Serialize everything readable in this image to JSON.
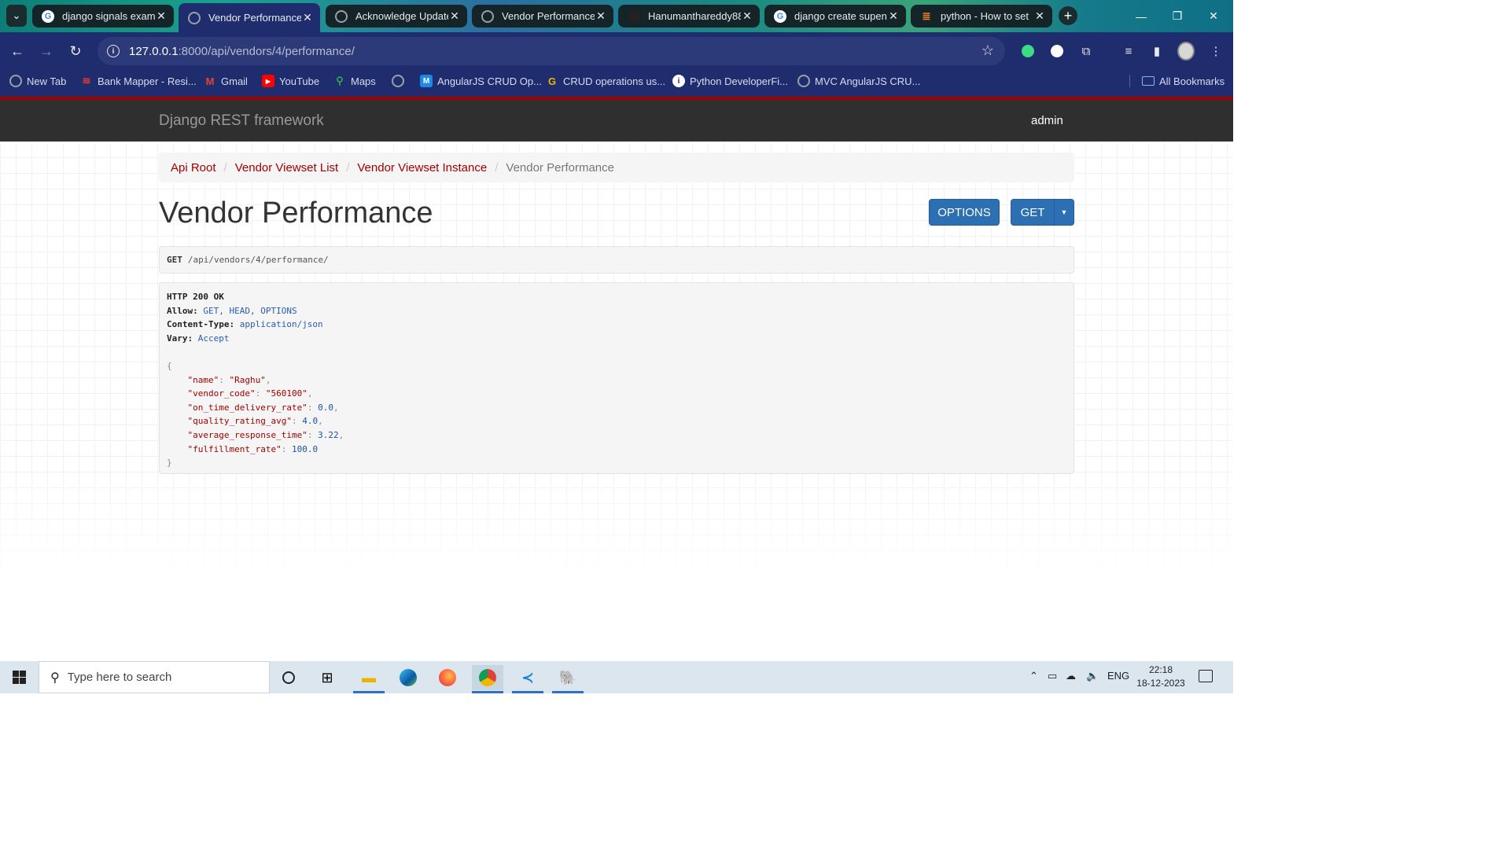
{
  "browser": {
    "tabs": [
      {
        "title": "django signals examp",
        "icon": "google-icon"
      },
      {
        "title": "Vendor Performance",
        "icon": "globe-icon"
      },
      {
        "title": "Acknowledge Update",
        "icon": "globe-icon"
      },
      {
        "title": "Vendor Performance",
        "icon": "globe-icon"
      },
      {
        "title": "Hanumanthareddy88",
        "icon": "github-icon"
      },
      {
        "title": "django create supen",
        "icon": "google-icon"
      },
      {
        "title": "python - How to set",
        "icon": "stackoverflow-icon"
      }
    ],
    "url_host": "127.0.0.1",
    "url_rest": ":8000/api/vendors/4/performance/",
    "bookmarks": [
      {
        "label": "New Tab"
      },
      {
        "label": "Bank Mapper - Resi..."
      },
      {
        "label": "Gmail"
      },
      {
        "label": "YouTube"
      },
      {
        "label": "Maps"
      },
      {
        "label": ""
      },
      {
        "label": "AngularJS CRUD Op..."
      },
      {
        "label": "CRUD operations us..."
      },
      {
        "label": "Python DeveloperFi..."
      },
      {
        "label": "MVC AngularJS CRU..."
      }
    ],
    "all_bookmarks": "All Bookmarks"
  },
  "drf": {
    "brand": "Django REST framework",
    "user": "admin",
    "breadcrumbs": [
      "Api Root",
      "Vendor Viewset List",
      "Vendor Viewset Instance"
    ],
    "breadcrumb_current": "Vendor Performance",
    "title": "Vendor Performance",
    "options_label": "OPTIONS",
    "get_label": "GET",
    "request_method": "GET",
    "request_path": "/api/vendors/4/performance/",
    "response": {
      "status": "HTTP 200 OK",
      "allow_key": "Allow:",
      "allow_val": "GET, HEAD, OPTIONS",
      "ctype_key": "Content-Type:",
      "ctype_val": "application/json",
      "vary_key": "Vary:",
      "vary_val": "Accept",
      "fields": [
        {
          "key": "\"name\"",
          "value": "\"Raghu\"",
          "type": "str"
        },
        {
          "key": "\"vendor_code\"",
          "value": "\"560100\"",
          "type": "str"
        },
        {
          "key": "\"on_time_delivery_rate\"",
          "value": "0.0",
          "type": "num"
        },
        {
          "key": "\"quality_rating_avg\"",
          "value": "4.0",
          "type": "num"
        },
        {
          "key": "\"average_response_time\"",
          "value": "3.22",
          "type": "num"
        },
        {
          "key": "\"fulfillment_rate\"",
          "value": "100.0",
          "type": "num"
        }
      ]
    }
  },
  "taskbar": {
    "search_placeholder": "Type here to search",
    "lang": "ENG",
    "time": "22:18",
    "date": "18-12-2023"
  },
  "colors": {
    "drf_red": "#a30000",
    "drf_navbar": "#2f2f2f",
    "button_blue": "#2c6fb3",
    "chrome_toolbar": "#1f2c6e"
  }
}
